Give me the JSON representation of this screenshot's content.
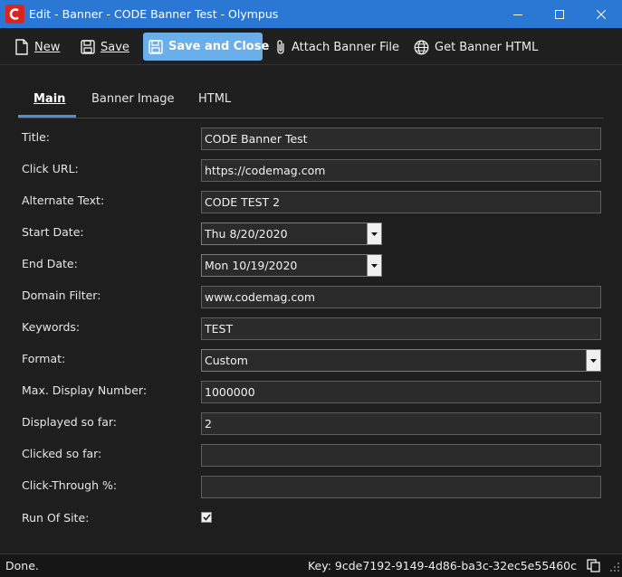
{
  "window": {
    "title": "Edit - Banner - CODE Banner Test - Olympus",
    "app_icon": "C"
  },
  "toolbar": {
    "new_label": "New",
    "save_label": "Save",
    "save_close_label": "Save and Close",
    "attach_label": "Attach Banner File",
    "get_html_label": "Get Banner HTML",
    "accent_color": "#6aaeea"
  },
  "tabs": [
    {
      "label": "Main",
      "active": true
    },
    {
      "label": "Banner Image",
      "active": false
    },
    {
      "label": "HTML",
      "active": false
    }
  ],
  "form": {
    "title": {
      "label": "Title:",
      "value": "CODE Banner Test"
    },
    "click_url": {
      "label": "Click URL:",
      "value": "https://codemag.com"
    },
    "alt_text": {
      "label": "Alternate Text:",
      "value": "CODE TEST 2"
    },
    "start_date": {
      "label": "Start Date:",
      "value": "Thu 8/20/2020"
    },
    "end_date": {
      "label": "End Date:",
      "value": "Mon 10/19/2020"
    },
    "domain_filter": {
      "label": "Domain Filter:",
      "value": "www.codemag.com"
    },
    "keywords": {
      "label": "Keywords:",
      "value": "TEST"
    },
    "format": {
      "label": "Format:",
      "value": "Custom"
    },
    "max_display": {
      "label": "Max. Display Number:",
      "value": "1000000"
    },
    "displayed": {
      "label": "Displayed so far:",
      "value": "2"
    },
    "clicked": {
      "label": "Clicked so far:",
      "value": ""
    },
    "click_through": {
      "label": "Click-Through %:",
      "value": ""
    },
    "run_of_site": {
      "label": "Run Of Site:",
      "checked": true
    }
  },
  "status": {
    "text": "Done.",
    "key": "Key: 9cde7192-9149-4d86-ba3c-32ec5e55460c"
  }
}
